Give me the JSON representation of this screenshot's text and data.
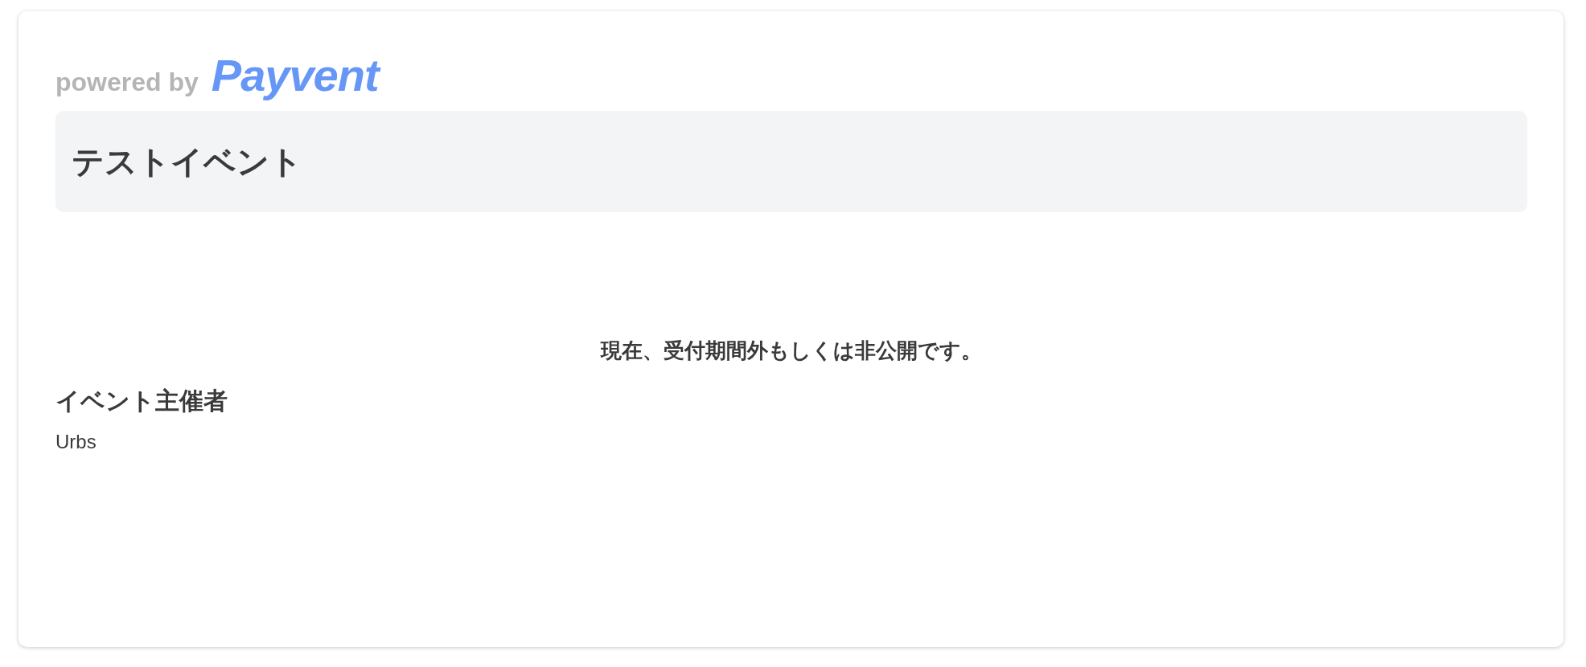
{
  "branding": {
    "prefix": "powered by",
    "logo": "Payvent"
  },
  "event": {
    "title": "テストイベント"
  },
  "notice": "現在、受付期間外もしくは非公開です。",
  "organizer": {
    "heading": "イベント主催者",
    "name": "Urbs"
  }
}
